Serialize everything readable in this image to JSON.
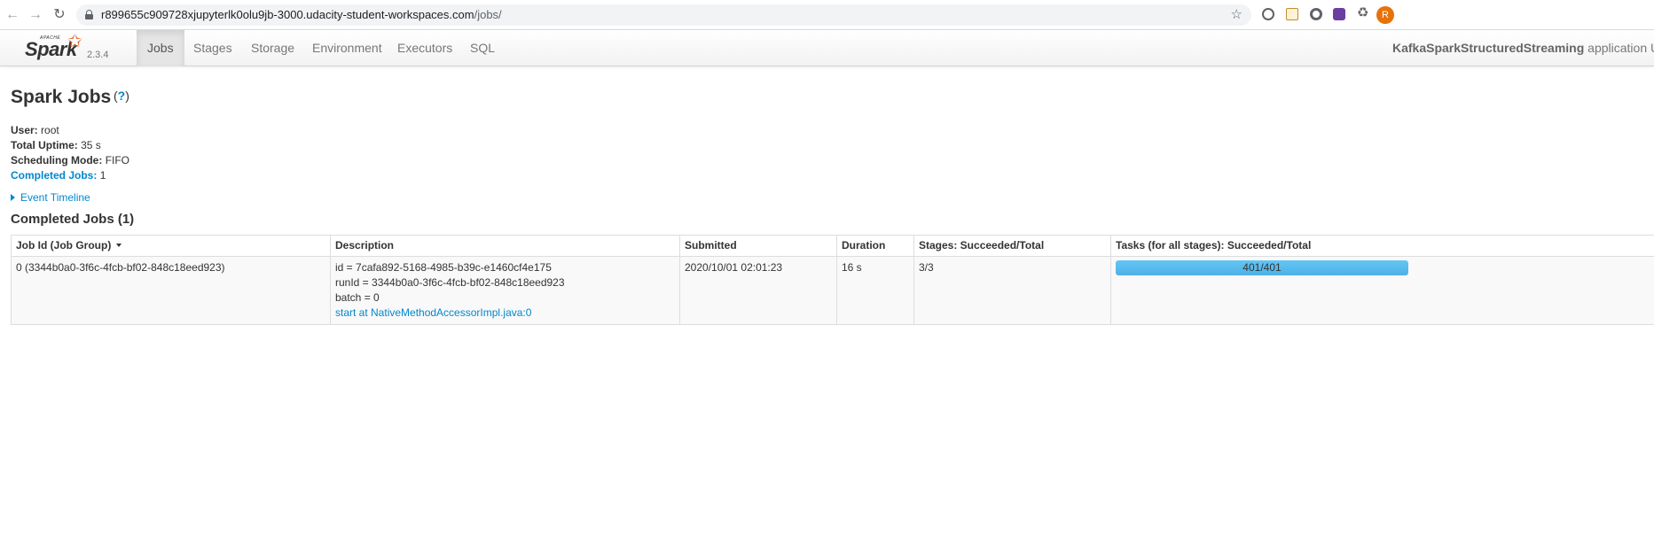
{
  "browser": {
    "url_host": "r899655c909728xjupyterlk0olu9jb-3000.udacity-student-workspaces.com",
    "url_path": "/jobs/",
    "profile_initial": "R"
  },
  "navbar": {
    "apache": "APACHE",
    "brand": "Spark",
    "version": "2.3.4",
    "tabs": [
      {
        "label": "Jobs",
        "active": true
      },
      {
        "label": "Stages"
      },
      {
        "label": "Storage"
      },
      {
        "label": "Environment"
      },
      {
        "label": "Executors"
      },
      {
        "label": "SQL"
      }
    ],
    "app_name": "KafkaSparkStructuredStreaming",
    "app_suffix": "application UI"
  },
  "page": {
    "title": "Spark Jobs",
    "help": "?",
    "summary": {
      "user_label": "User:",
      "user_value": "root",
      "uptime_label": "Total Uptime:",
      "uptime_value": "35 s",
      "mode_label": "Scheduling Mode:",
      "mode_value": "FIFO",
      "completed_label": "Completed Jobs:",
      "completed_value": "1"
    },
    "event_timeline": "Event Timeline",
    "section_title": "Completed Jobs (1)"
  },
  "table": {
    "headers": [
      "Job Id (Job Group)",
      "Description",
      "Submitted",
      "Duration",
      "Stages: Succeeded/Total",
      "Tasks (for all stages): Succeeded/Total"
    ],
    "rows": [
      {
        "job_id": "0 (3344b0a0-3f6c-4fcb-bf02-848c18eed923)",
        "desc_line1": "id = 7cafa892-5168-4985-b39c-e1460cf4e175",
        "desc_line2": "runId = 3344b0a0-3f6c-4fcb-bf02-848c18eed923",
        "desc_line3": "batch = 0",
        "desc_link": "start at NativeMethodAccessorImpl.java:0",
        "submitted": "2020/10/01 02:01:23",
        "duration": "16 s",
        "stages": "3/3",
        "tasks": "401/401",
        "tasks_progress": 1.0
      }
    ]
  }
}
